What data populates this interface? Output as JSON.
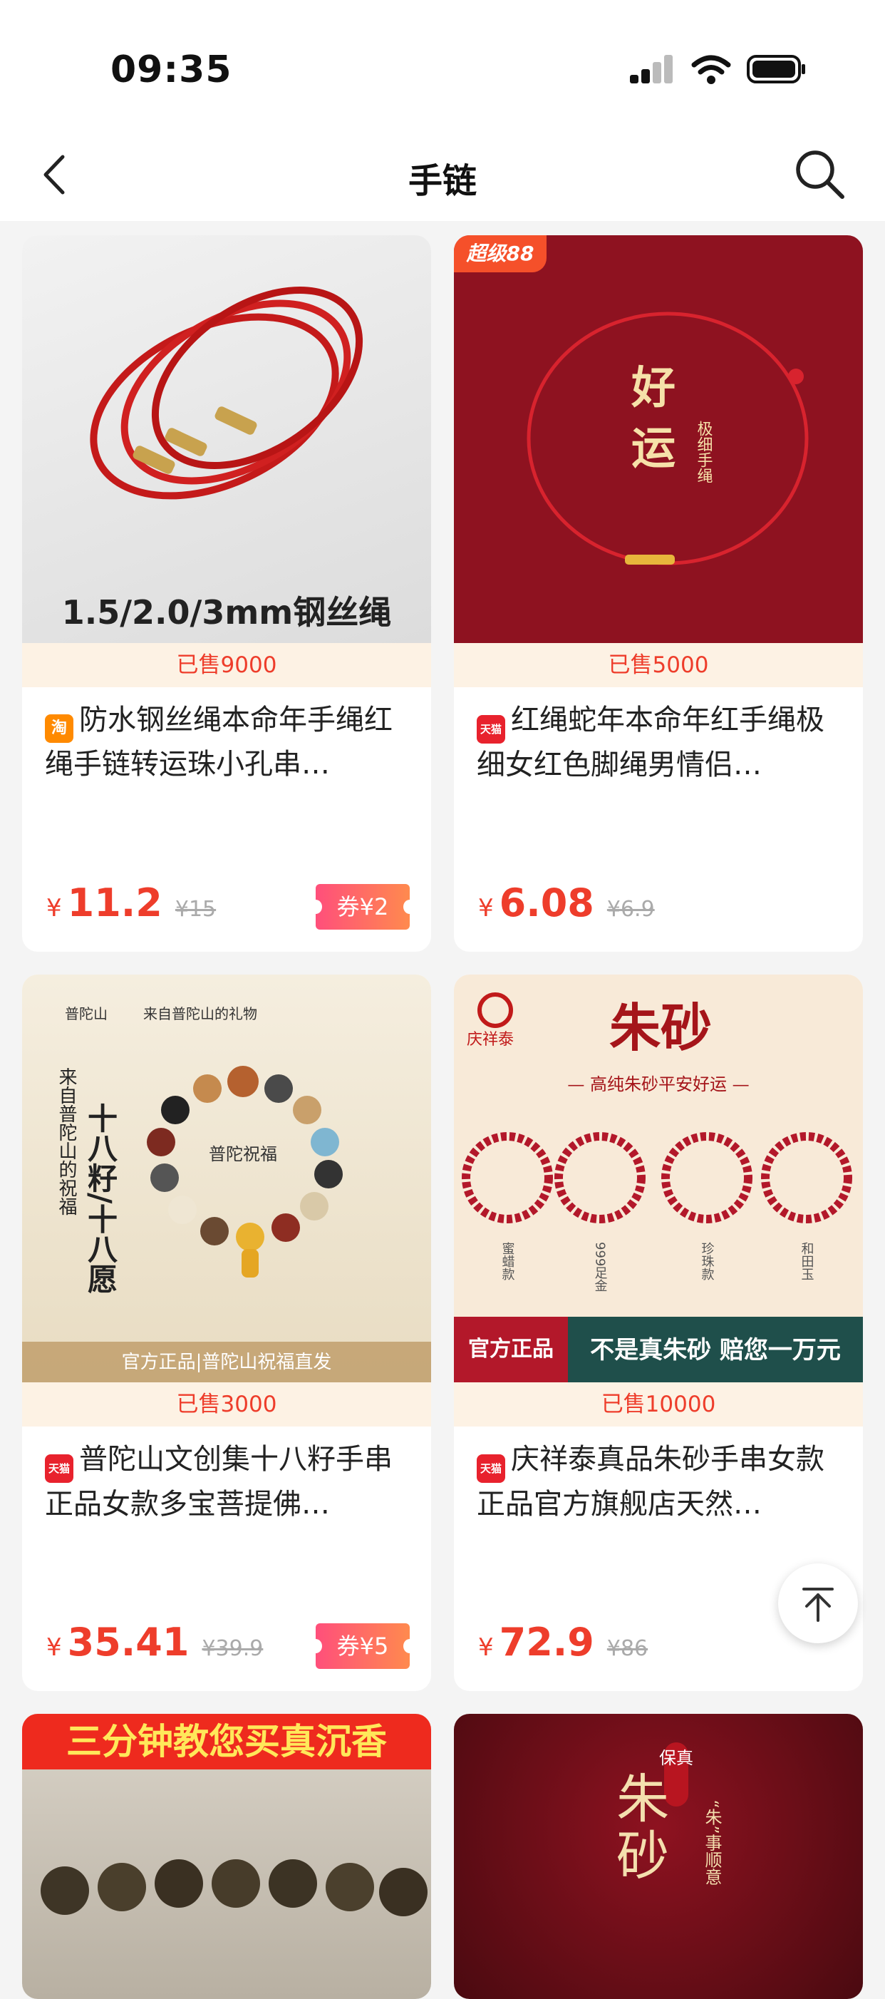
{
  "status_bar": {
    "time": "09:35"
  },
  "nav": {
    "title": "手链"
  },
  "products": [
    {
      "sold": "已售9000",
      "shop_badge": "淘",
      "title": "防水钢丝绳本命年手绳红绳手链转运珠小孔串…",
      "price": "11.2",
      "original_price": "¥15",
      "coupon": "券¥2",
      "image_caption": "1.5/2.0/3mm钢丝绳",
      "image_text": []
    },
    {
      "sold": "已售5000",
      "shop_badge": "天猫",
      "title": "红绳蛇年本命年红手绳极细女红色脚绳男情侣…",
      "price": "6.08",
      "original_price": "¥6.9",
      "coupon": "",
      "badge": "超级88",
      "image_text": [
        "好",
        "运",
        "极细手绳"
      ]
    },
    {
      "sold": "已售3000",
      "shop_badge": "天猫",
      "title": "普陀山文创集十八籽手串正品女款多宝菩提佛…",
      "price": "35.41",
      "original_price": "¥39.9",
      "coupon": "券¥5",
      "image_text": [
        "普陀山",
        "来自普陀山的礼物",
        "来自普陀山的祝福",
        "十八籽/十八愿",
        "普陀祝福",
        "官方正品|普陀山祝福直发"
      ]
    },
    {
      "sold": "已售10000",
      "shop_badge": "天猫",
      "title": "庆祥泰真品朱砂手串女款正品官方旗舰店天然…",
      "price": "72.9",
      "original_price": "¥86",
      "coupon": "",
      "image_text": [
        "庆祥泰",
        "朱砂",
        "— 高纯朱砂平安好运 —",
        "蜜蜡款",
        "999足金",
        "珍珠款",
        "和田玉",
        "官方正品",
        "不是真朱砂 赔您一万元"
      ]
    },
    {
      "image_text": [
        "三分钟教您买真沉香"
      ]
    },
    {
      "image_text": [
        "保真",
        "朱",
        "砂",
        "“朱”事顺意"
      ]
    }
  ],
  "currency_symbol": "¥",
  "colors": {
    "accent": "#ee3d2b",
    "sold_bg": "#fdf2e4",
    "coupon_start": "#ff4f7b",
    "coupon_end": "#ff8a4e",
    "taobao": "#ff8a00",
    "tmall": "#e8222d"
  }
}
